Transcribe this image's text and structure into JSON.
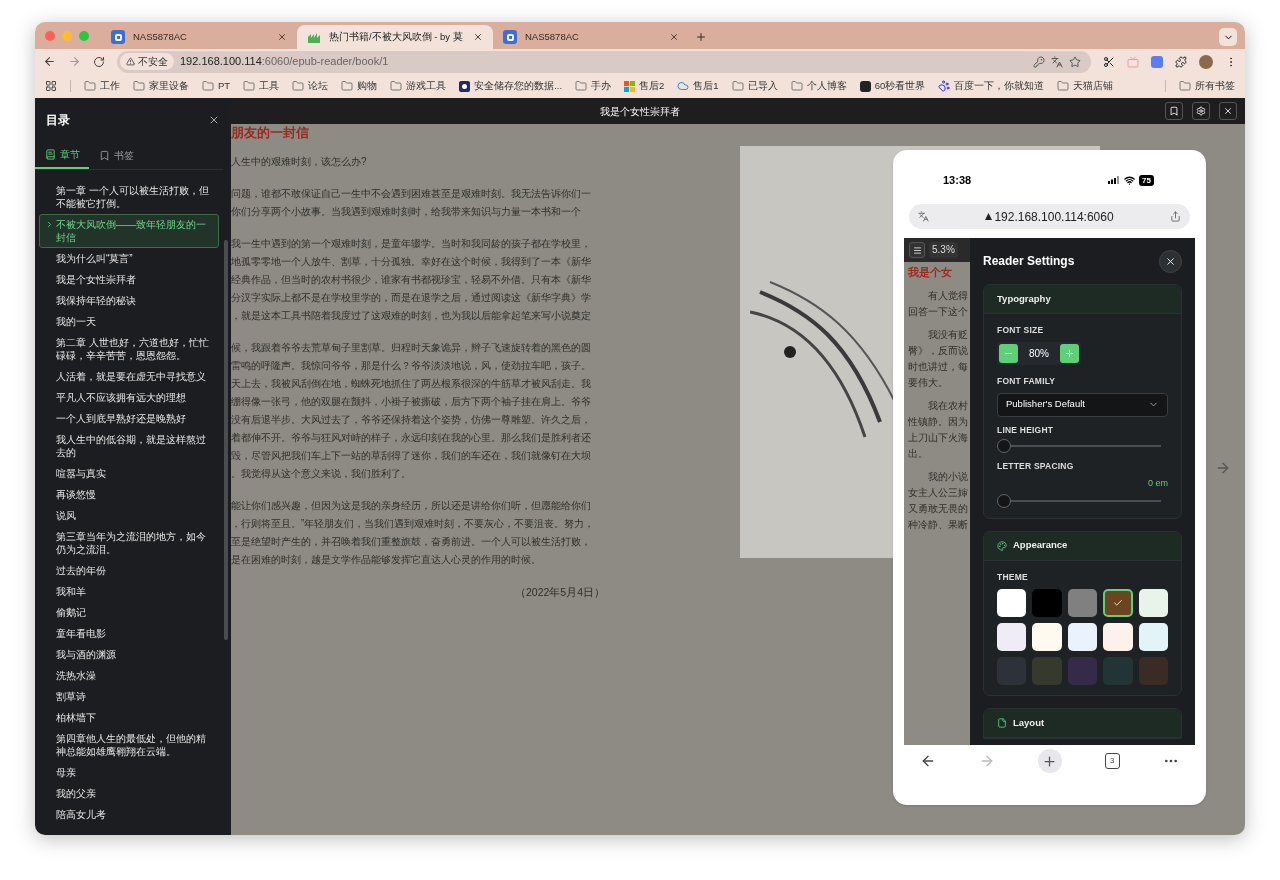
{
  "browser": {
    "tabs": [
      {
        "title": "NAS5878AC",
        "kind": "nas",
        "selected": false
      },
      {
        "title": "热门书籍/不被大风吹倒 - by 莫",
        "kind": "book",
        "selected": true
      },
      {
        "title": "NAS5878AC",
        "kind": "nas",
        "selected": false
      }
    ],
    "security": "不安全",
    "host": "192.168.100.114",
    "path": ":6060/epub-reader/book/1",
    "bookmarks": [
      {
        "label": "工作",
        "kind": "folder"
      },
      {
        "label": "家里设备",
        "kind": "folder"
      },
      {
        "label": "PT",
        "kind": "folder"
      },
      {
        "label": "工具",
        "kind": "folder"
      },
      {
        "label": "论坛",
        "kind": "folder"
      },
      {
        "label": "购物",
        "kind": "folder"
      },
      {
        "label": "游戏工具",
        "kind": "folder"
      },
      {
        "label": "安全储存您的数据...",
        "kind": "app"
      },
      {
        "label": "手办",
        "kind": "folder"
      },
      {
        "label": "售后2",
        "kind": "windows"
      },
      {
        "label": "售后1",
        "kind": "cloud"
      },
      {
        "label": "已导入",
        "kind": "folder"
      },
      {
        "label": "个人博客",
        "kind": "folder"
      },
      {
        "label": "60秒看世界",
        "kind": "portrait"
      },
      {
        "label": "百度一下，你就知道",
        "kind": "paw"
      },
      {
        "label": "天猫店铺",
        "kind": "folder"
      }
    ],
    "all_bookmarks": "所有书签"
  },
  "toc": {
    "title": "目录",
    "tabs": [
      {
        "label": "章节",
        "kind": "chapters",
        "selected": true
      },
      {
        "label": "书签",
        "kind": "bookmarks",
        "selected": false
      }
    ],
    "items": [
      {
        "label": "第一章 一个人可以被生活打败，但不能被它打倒。",
        "selected": false
      },
      {
        "label": "不被大风吹倒——致年轻朋友的一封信",
        "selected": true
      },
      {
        "label": "我为什么叫“莫言”",
        "selected": false
      },
      {
        "label": "我是个女性崇拜者",
        "selected": false
      },
      {
        "label": "我保持年轻的秘诀",
        "selected": false
      },
      {
        "label": "我的一天",
        "selected": false
      },
      {
        "label": "第二章 人世也好，六道也好，忙忙碌碌，辛辛苦苦，恩恩怨怨。",
        "selected": false
      },
      {
        "label": "人活着，就是要在虚无中寻找意义",
        "selected": false
      },
      {
        "label": "平凡人不应该拥有远大的理想",
        "selected": false
      },
      {
        "label": "一个人到底早熟好还是晚熟好",
        "selected": false
      },
      {
        "label": "我人生中的低谷期，就是这样熬过去的",
        "selected": false
      },
      {
        "label": "喧嚣与真实",
        "selected": false
      },
      {
        "label": "再谈悠慢",
        "selected": false
      },
      {
        "label": "说风",
        "selected": false
      },
      {
        "label": "第三章当年为之流泪的地方，如今仍为之流泪。",
        "selected": false
      },
      {
        "label": "过去的年份",
        "selected": false
      },
      {
        "label": "我和羊",
        "selected": false
      },
      {
        "label": "偷鹅记",
        "selected": false
      },
      {
        "label": "童年看电影",
        "selected": false
      },
      {
        "label": "我与酒的渊源",
        "selected": false
      },
      {
        "label": "洗热水澡",
        "selected": false
      },
      {
        "label": "割草诗",
        "selected": false
      },
      {
        "label": "柏林墙下",
        "selected": false
      },
      {
        "label": "第四章他人生的最低处，但他的精神总能如雄鹰翱翔在云端。",
        "selected": false
      },
      {
        "label": "母亲",
        "selected": false
      },
      {
        "label": "我的父亲",
        "selected": false
      },
      {
        "label": "陪高女儿考",
        "selected": false
      }
    ]
  },
  "reader": {
    "title": "我是个女性崇拜者",
    "heading": "朋友的一封信",
    "paragraphs": [
      [
        "人生中的艰难时刻，该怎么办?"
      ],
      [
        "问题，谁都不敢保证自己一生中不会遇到困难甚至是艰难时刻。我无法告诉你们一",
        "你们分享两个小故事。当我遇到艰难时刻时，给我带来知识与力量一本书和一个"
      ],
      [
        "我一生中遇到的第一个艰难时刻，是童年辍学。当时和我同龄的孩子都在学校里，",
        "地孤零零地一个人放牛、割草，十分孤独。幸好在这个时候，我得到了一本《新华",
        "经典作品，但当时的农村书很少，谁家有书都视珍宝，轻易不外借。只有本《新华",
        "分汉字实际上都不是在学校里学的，而是在退学之后，通过阅读这《新华字典》学",
        "，就是这本工具书陪着我度过了这艰难的时刻，也为我以后能拿起笔来写小说奠定"
      ],
      [
        "候，我跟着爷爷去荒草甸子里割草。归程时天象诡异，辫子飞速旋转着的黑色的圆",
        "雷鸣的呼隆声。我惊问爷爷，那是什么？爷爷淡淡地说，风，使劲拉车吧，孩子。",
        "天上去，我被风刮倒在地，蜘蛛死地抓住了两丛根系很深的牛筋草才被风刮走。我",
        "绷得像一张弓，他的双腿在颤抖，小褂子被撕破，后方下两个袖子挂在肩上。爷爷",
        "没有后退半步。大风过去了，爷爷还保持着这个姿势，仿佛一尊雕塑。许久之后，",
        "着都伸不开。爷爷与狂风对峙的样子，永远印刻在我的心里。那么我们是胜利者还",
        "毁，尽管风把我们车上下一站的草刮得了迷你，我们的车还在，我们就像钉在大坝",
        "。我觉得从这个意义来说，我们胜利了。"
      ],
      [
        "能让你们感兴趣，但因为这是我的亲身经历，所以还是讲给你们听，但愿能给你们",
        "，行则将至且。”年轻朋友们，当我们遇到艰难时刻，不要灰心，不要沮丧。努力，",
        "至是绝望时产生的，并召唤着我们重整旗鼓，奋勇前进。一个人可以被生活打败，",
        "是在困难的时刻，越是文学作品能够发挥它直达人心灵的作用的时候。"
      ]
    ],
    "date": "（2022年5月4日）"
  },
  "phone": {
    "time": "13:38",
    "battery": "75",
    "url": "192.168.100.114:6060",
    "page": {
      "progress": "5.3%",
      "heading": "我是个女",
      "paragraphs": [
        [
          "有人觉得",
          "回答一下这个"
        ],
        [
          "我没有贬",
          "臀》，反而说",
          "时也讲过，每",
          "要伟大。"
        ],
        [
          "我在农村",
          "性镇静。因为",
          "上刀山下火海",
          "出。"
        ],
        [
          "我的小说",
          "女主人公三婶",
          "又勇敢无畏的",
          "种冷静、果断"
        ]
      ]
    },
    "settings": {
      "title": "Reader Settings",
      "sections": [
        {
          "kind": "typography",
          "title": "Typography",
          "font_size_label": "FONT SIZE",
          "font_size": "80%",
          "font_family_label": "FONT FAMILY",
          "font_family": "Publisher's Default",
          "sliders": [
            {
              "label": "LINE HEIGHT",
              "level": 0
            },
            {
              "label": "LETTER SPACING",
              "reading": "0 em",
              "level": 0
            }
          ]
        },
        {
          "kind": "appearance",
          "title": "Appearance",
          "theme_label": "THEME",
          "themes": [
            {
              "color": "#ffffff",
              "selected": false
            },
            {
              "color": "#000000",
              "selected": false
            },
            {
              "color": "#808080",
              "selected": false
            },
            {
              "color": "#6b4420",
              "selected": true
            },
            {
              "color": "#e8f3ea",
              "selected": false
            },
            {
              "color": "#f0ecf7",
              "selected": false
            },
            {
              "color": "#fffaf0",
              "selected": false
            },
            {
              "color": "#eaf2fd",
              "selected": false
            },
            {
              "color": "#fdf1ec",
              "selected": false
            },
            {
              "color": "#e3f4f9",
              "selected": false
            },
            {
              "color": "#2d3139",
              "selected": false
            },
            {
              "color": "#363a2c",
              "selected": false
            },
            {
              "color": "#352a48",
              "selected": false
            },
            {
              "color": "#233436",
              "selected": false
            },
            {
              "color": "#3a2b25",
              "selected": false
            }
          ]
        },
        {
          "kind": "layout",
          "title": "Layout"
        }
      ]
    },
    "tab_count": "3"
  }
}
